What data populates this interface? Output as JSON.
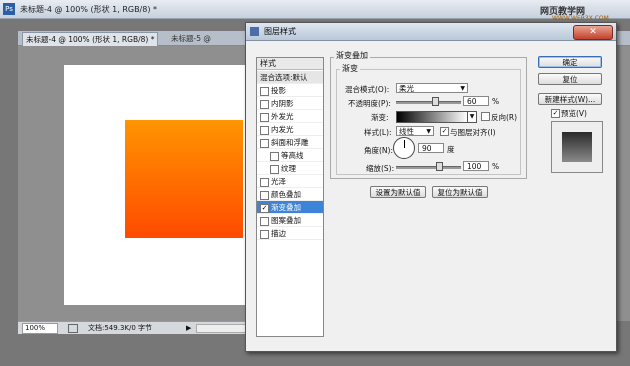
{
  "app": {
    "title": "未标题-4 @ 100% (形状 1, RGB/8) *",
    "ps_icon": "Ps",
    "watermark": "网页教学网",
    "watermark_sub": "WWW.WEB3X.COM"
  },
  "tabs": [
    {
      "label": "未标题-4 @ 100% (形状 1, RGB/8) *"
    },
    {
      "label": "未标题-5 @"
    }
  ],
  "canvas": {
    "gradient_start": "#ff9500",
    "gradient_end": "#ff4a00"
  },
  "status": {
    "zoom": "100%",
    "doc_info": "文档:549.3K/0 字节"
  },
  "dialog": {
    "title": "图层样式",
    "close_icon": "close-icon",
    "styles_header": "样式",
    "blend_options": "混合选项:默认",
    "style_items": [
      {
        "label": "投影",
        "checked": false,
        "sub": false
      },
      {
        "label": "内阴影",
        "checked": false,
        "sub": false
      },
      {
        "label": "外发光",
        "checked": false,
        "sub": false
      },
      {
        "label": "内发光",
        "checked": false,
        "sub": false
      },
      {
        "label": "斜面和浮雕",
        "checked": false,
        "sub": false
      },
      {
        "label": "等高线",
        "checked": false,
        "sub": true
      },
      {
        "label": "纹理",
        "checked": false,
        "sub": true
      },
      {
        "label": "光泽",
        "checked": false,
        "sub": false
      },
      {
        "label": "颜色叠加",
        "checked": false,
        "sub": false
      },
      {
        "label": "渐变叠加",
        "checked": true,
        "sub": false,
        "selected": true
      },
      {
        "label": "图案叠加",
        "checked": false,
        "sub": false
      },
      {
        "label": "描边",
        "checked": false,
        "sub": false
      }
    ],
    "section_title": "渐变叠加",
    "sub_title": "渐变",
    "blend_mode_label": "混合模式(O):",
    "blend_mode_value": "柔光",
    "opacity_label": "不透明度(P):",
    "opacity_value": "60",
    "percent": "%",
    "gradient_label": "渐变:",
    "reverse_label": "反向(R)",
    "reverse_checked": false,
    "style_label": "样式(L):",
    "style_value": "线性",
    "align_label": "与图层对齐(I)",
    "align_checked": true,
    "angle_label": "角度(N):",
    "angle_value": "90",
    "degree": "度",
    "scale_label": "缩放(S):",
    "scale_value": "100",
    "set_default": "设置为默认值",
    "reset_default": "复位为默认值",
    "ok": "确定",
    "reset": "复位",
    "new_style": "新建样式(W)...",
    "preview_label": "预览(V)",
    "preview_checked": true
  }
}
